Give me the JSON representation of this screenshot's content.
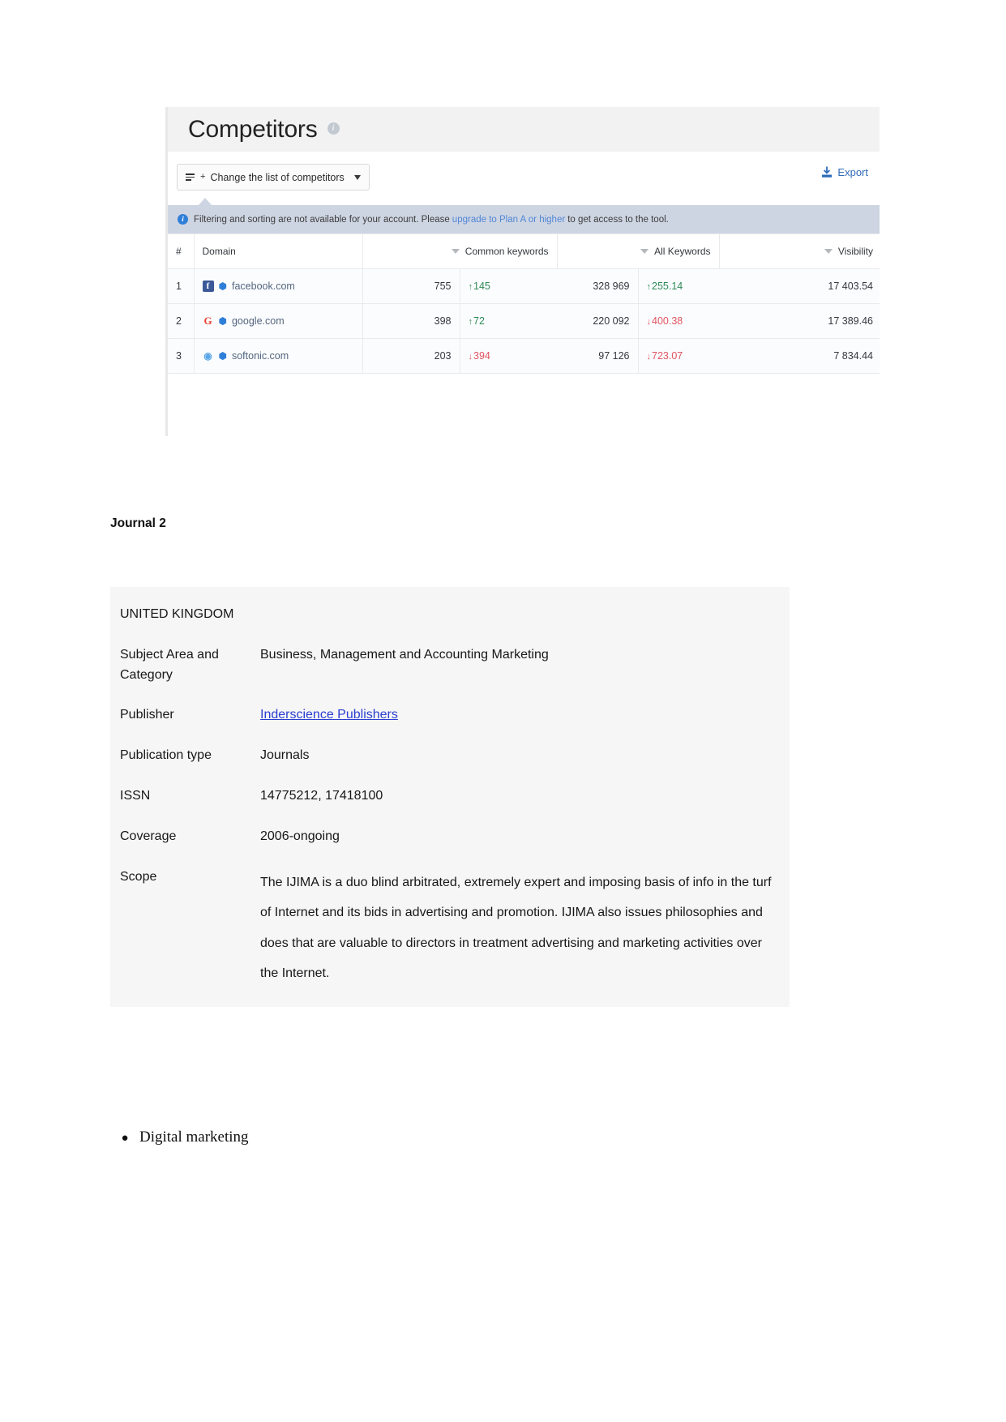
{
  "semrush": {
    "title": "Competitors",
    "info_icon": "info-icon",
    "change_button": "Change the list of competitors",
    "export_label": "Export",
    "notice": {
      "prefix": "Filtering and sorting are not available for your account. Please",
      "link": "upgrade to Plan A or higher",
      "suffix": "to get access to the tool."
    },
    "columns": {
      "num": "#",
      "domain": "Domain",
      "common_keywords": "Common keywords",
      "all_keywords": "All Keywords",
      "visibility": "Visibility"
    },
    "rows": [
      {
        "num": "1",
        "favicon": "facebook-favicon",
        "domain": "facebook.com",
        "common_keywords": "755",
        "common_keywords_delta": "145",
        "common_keywords_dir": "up",
        "all_keywords": "328 969",
        "all_keywords_delta": "255.14",
        "all_keywords_dir": "up",
        "visibility": "17 403.54"
      },
      {
        "num": "2",
        "favicon": "google-favicon",
        "domain": "google.com",
        "common_keywords": "398",
        "common_keywords_delta": "72",
        "common_keywords_dir": "up",
        "all_keywords": "220 092",
        "all_keywords_delta": "400.38",
        "all_keywords_dir": "down",
        "visibility": "17 389.46"
      },
      {
        "num": "3",
        "favicon": "softonic-favicon",
        "domain": "softonic.com",
        "common_keywords": "203",
        "common_keywords_delta": "394",
        "common_keywords_dir": "down",
        "all_keywords": "97 126",
        "all_keywords_delta": "723.07",
        "all_keywords_dir": "down",
        "visibility": "7 834.44"
      }
    ],
    "colors": {
      "up": "#2e8b57",
      "down": "#e05561",
      "link": "#2e6bb8",
      "notice_bg": "#ced5e2"
    }
  },
  "document": {
    "heading": "Journal 2",
    "journal_rows": [
      {
        "label": "UNITED KINGDOM",
        "value": ""
      },
      {
        "label": "Subject Area and Category",
        "value": "Business, Management and Accounting Marketing"
      },
      {
        "label": "Publisher",
        "value": "Inderscience Publishers",
        "is_link": true
      },
      {
        "label": "Publication type",
        "value": "Journals"
      },
      {
        "label": "ISSN",
        "value": "14775212, 17418100"
      },
      {
        "label": "Coverage",
        "value": "2006-ongoing"
      },
      {
        "label": "Scope",
        "value": "The IJIMA is a duo blind arbitrated, extremely expert and imposing basis of info in the turf of Internet and its bids in advertising and promotion. IJIMA also issues philosophies and does that are valuable to directors in treatment advertising and marketing activities over the Internet."
      }
    ],
    "bullet": "Digital marketing"
  }
}
